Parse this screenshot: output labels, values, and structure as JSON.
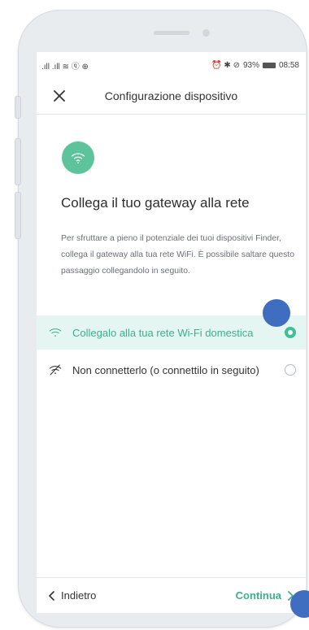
{
  "status_bar": {
    "left": ".ıll .ıll ≋ ⓠ ⊕",
    "right_icons": "⏰ ✱ ⊘",
    "battery": "93%",
    "time": "08:58"
  },
  "header": {
    "title": "Configurazione dispositivo",
    "close_icon": "close-icon"
  },
  "hero": {
    "icon": "wifi-icon",
    "color": "#5cc39a"
  },
  "page": {
    "title": "Collega il tuo gateway alla rete",
    "description": "Per sfruttare a pieno il potenziale dei tuoi dispositivi Finder, collega il gateway alla tua rete WiFi. È possibile saltare questo passaggio collegandolo in seguito."
  },
  "options": [
    {
      "label": "Collegalo alla tua rete Wi-Fi domestica",
      "icon": "wifi-icon",
      "selected": true
    },
    {
      "label": "Non connetterlo (o connettilo in seguito)",
      "icon": "wifi-off-icon",
      "selected": false
    }
  ],
  "footer": {
    "back_label": "Indietro",
    "next_label": "Continua"
  },
  "colors": {
    "accent": "#3bb08a",
    "selected_bg": "#e5f6f2",
    "touch_marker": "#3f6ec0"
  }
}
